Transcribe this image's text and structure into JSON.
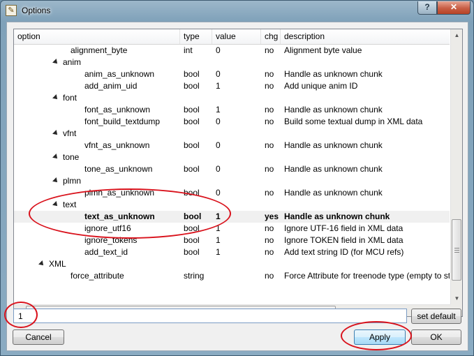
{
  "window": {
    "title": "Options",
    "help_label": "?",
    "close_label": "✕"
  },
  "tree": {
    "columns": [
      "option",
      "type",
      "value",
      "chg",
      "description"
    ],
    "rows": [
      {
        "indent": 3,
        "expander": false,
        "option": "alignment_byte",
        "type": "int",
        "value": "0",
        "chg": "no",
        "description": "Alignment byte value",
        "selected": false
      },
      {
        "indent": 2,
        "expander": true,
        "option": "anim",
        "type": "",
        "value": "",
        "chg": "",
        "description": "",
        "selected": false
      },
      {
        "indent": 4,
        "expander": false,
        "option": "anim_as_unknown",
        "type": "bool",
        "value": "0",
        "chg": "no",
        "description": "Handle as unknown chunk",
        "selected": false
      },
      {
        "indent": 4,
        "expander": false,
        "option": "add_anim_uid",
        "type": "bool",
        "value": "1",
        "chg": "no",
        "description": "Add unique anim ID",
        "selected": false
      },
      {
        "indent": 2,
        "expander": true,
        "option": "font",
        "type": "",
        "value": "",
        "chg": "",
        "description": "",
        "selected": false
      },
      {
        "indent": 4,
        "expander": false,
        "option": "font_as_unknown",
        "type": "bool",
        "value": "1",
        "chg": "no",
        "description": "Handle as unknown chunk",
        "selected": false
      },
      {
        "indent": 4,
        "expander": false,
        "option": "font_build_textdump",
        "type": "bool",
        "value": "0",
        "chg": "no",
        "description": "Build some textual dump in XML data",
        "selected": false
      },
      {
        "indent": 2,
        "expander": true,
        "option": "vfnt",
        "type": "",
        "value": "",
        "chg": "",
        "description": "",
        "selected": false
      },
      {
        "indent": 4,
        "expander": false,
        "option": "vfnt_as_unknown",
        "type": "bool",
        "value": "0",
        "chg": "no",
        "description": "Handle as unknown chunk",
        "selected": false
      },
      {
        "indent": 2,
        "expander": true,
        "option": "tone",
        "type": "",
        "value": "",
        "chg": "",
        "description": "",
        "selected": false
      },
      {
        "indent": 4,
        "expander": false,
        "option": "tone_as_unknown",
        "type": "bool",
        "value": "0",
        "chg": "no",
        "description": "Handle as unknown chunk",
        "selected": false
      },
      {
        "indent": 2,
        "expander": true,
        "option": "plmn",
        "type": "",
        "value": "",
        "chg": "",
        "description": "",
        "selected": false
      },
      {
        "indent": 4,
        "expander": false,
        "option": "plmn_as_unknown",
        "type": "bool",
        "value": "0",
        "chg": "no",
        "description": "Handle as unknown chunk",
        "selected": false
      },
      {
        "indent": 2,
        "expander": true,
        "option": "text",
        "type": "",
        "value": "",
        "chg": "",
        "description": "",
        "selected": false
      },
      {
        "indent": 4,
        "expander": false,
        "option": "text_as_unknown",
        "type": "bool",
        "value": "1",
        "chg": "yes",
        "description": "Handle as unknown chunk",
        "selected": true
      },
      {
        "indent": 4,
        "expander": false,
        "option": "ignore_utf16",
        "type": "bool",
        "value": "1",
        "chg": "no",
        "description": "Ignore UTF-16 field in XML data",
        "selected": false
      },
      {
        "indent": 4,
        "expander": false,
        "option": "ignore_tokens",
        "type": "bool",
        "value": "1",
        "chg": "no",
        "description": "Ignore TOKEN field in XML data",
        "selected": false
      },
      {
        "indent": 4,
        "expander": false,
        "option": "add_text_id",
        "type": "bool",
        "value": "1",
        "chg": "no",
        "description": "Add text string ID (for MCU refs)",
        "selected": false
      },
      {
        "indent": 1,
        "expander": true,
        "option": "XML",
        "type": "",
        "value": "",
        "chg": "",
        "description": "",
        "selected": false
      },
      {
        "indent": 3,
        "expander": false,
        "option": "force_attribute",
        "type": "string",
        "value": "",
        "chg": "no",
        "description": "Force Attribute for treenode type (empty to sto",
        "selected": false
      }
    ]
  },
  "value_field": {
    "value": "1"
  },
  "buttons": {
    "set_default": "set default",
    "cancel": "Cancel",
    "apply": "Apply",
    "ok": "OK"
  },
  "colors": {
    "annotation": "#d9121c",
    "default_button_border": "#3c7fb1"
  }
}
